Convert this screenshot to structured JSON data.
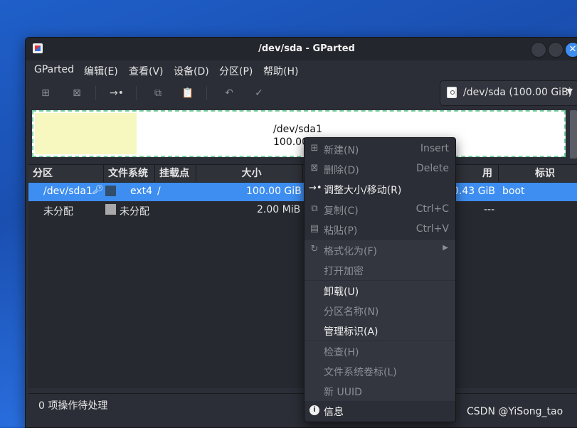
{
  "window": {
    "title": "/dev/sda - GParted"
  },
  "menubar": [
    "GParted",
    "编辑(E)",
    "查看(V)",
    "设备(D)",
    "分区(P)",
    "帮助(H)"
  ],
  "toolbar": {
    "icons": [
      "new-partition-icon",
      "delete-icon",
      "resize-move-icon",
      "copy-icon",
      "paste-icon",
      "undo-icon",
      "apply-icon"
    ]
  },
  "device_selector": {
    "label": "/dev/sda (100.00 GiB)"
  },
  "disk_map": {
    "used_color": "#f7f7c0",
    "partition_name": "/dev/sda1",
    "partition_size": "100.00 GiB"
  },
  "table": {
    "headers": [
      "分区",
      "文件系统",
      "挂载点",
      "大小",
      "",
      "",
      "标识"
    ],
    "rows": [
      {
        "partition": "/dev/sda1",
        "fs": "ext4",
        "mount": "/",
        "size": "100.00 GiB",
        "unused": "0.43 GiB",
        "flags": "boot",
        "fs_color": "#314e6c"
      },
      {
        "partition": "未分配",
        "fs": "未分配",
        "mount": "",
        "size": "2.00 MiB",
        "unused": "---",
        "flags": "",
        "fs_color": "#a9a9a9"
      }
    ],
    "header_hidden": "用"
  },
  "status": {
    "text": "0 项操作待处理"
  },
  "context_menu": [
    {
      "label": "新建(N)",
      "accel": "Insert",
      "enabled": false,
      "icon": "new-icon"
    },
    {
      "label": "删除(D)",
      "accel": "Delete",
      "enabled": false,
      "icon": "delete-icon"
    },
    {
      "label": "调整大小/移动(R)",
      "accel": "",
      "enabled": true,
      "icon": "resize-move-icon"
    },
    {
      "label": "复制(C)",
      "accel": "Ctrl+C",
      "enabled": false,
      "icon": "copy-icon"
    },
    {
      "label": "粘贴(P)",
      "accel": "Ctrl+V",
      "enabled": false,
      "icon": "paste-icon"
    },
    {
      "label": "格式化为(F)",
      "accel": "",
      "enabled": false,
      "icon": "format-icon",
      "submenu": true
    },
    {
      "label": "打开加密",
      "accel": "",
      "enabled": false,
      "icon": ""
    },
    {
      "label": "卸载(U)",
      "accel": "",
      "enabled": true,
      "icon": ""
    },
    {
      "label": "分区名称(N)",
      "accel": "",
      "enabled": false,
      "icon": ""
    },
    {
      "label": "管理标识(A)",
      "accel": "",
      "enabled": true,
      "icon": ""
    },
    {
      "label": "检查(H)",
      "accel": "",
      "enabled": false,
      "icon": ""
    },
    {
      "label": "文件系统卷标(L)",
      "accel": "",
      "enabled": false,
      "icon": ""
    },
    {
      "label": "新 UUID",
      "accel": "",
      "enabled": false,
      "icon": ""
    },
    {
      "label": "信息",
      "accel": "",
      "enabled": true,
      "icon": "info-icon"
    }
  ],
  "watermark": "CSDN @YiSong_tao",
  "colors": {
    "selection": "#3d8ef0",
    "window_bg": "#2b2e36"
  }
}
